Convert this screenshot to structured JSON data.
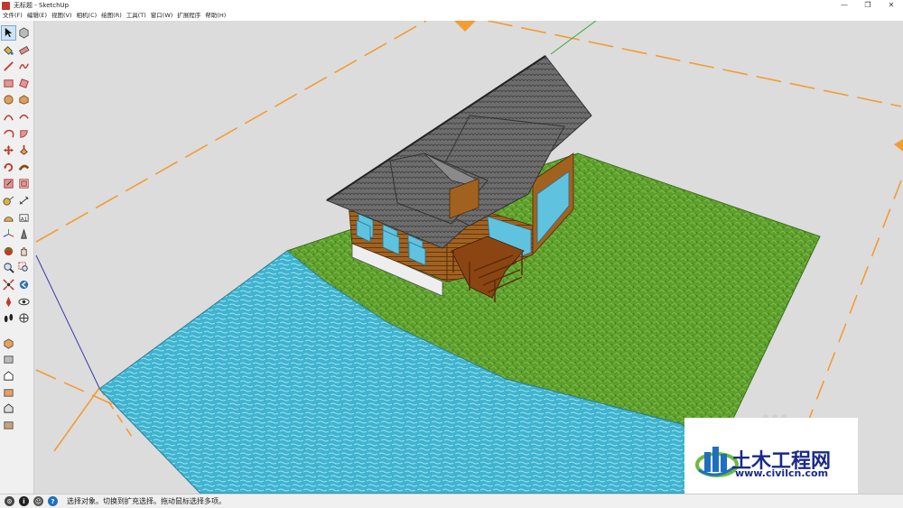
{
  "window": {
    "title": "无标题 - SketchUp",
    "controls": {
      "minimize": "—",
      "restore": "❐",
      "close": "✕"
    }
  },
  "menubar": {
    "items": [
      "文件(F)",
      "编辑(E)",
      "视图(V)",
      "相机(C)",
      "绘图(R)",
      "工具(T)",
      "窗口(W)",
      "扩展程序",
      "帮助(H)"
    ]
  },
  "toolbar": {
    "tools": [
      "select-icon",
      "component-icon",
      "paint-bucket-icon",
      "eraser-icon",
      "line-icon",
      "freehand-icon",
      "rectangle-icon",
      "rotated-rectangle-icon",
      "circle-icon",
      "polygon-icon",
      "arc-icon",
      "two-point-arc-icon",
      "three-point-arc-icon",
      "pie-icon",
      "move-icon",
      "push-pull-icon",
      "rotate-icon",
      "follow-me-icon",
      "scale-icon",
      "offset-icon",
      "tape-measure-icon",
      "dimension-icon",
      "protractor-icon",
      "text-icon",
      "axes-icon",
      "3d-text-icon",
      "orbit-icon",
      "pan-icon",
      "zoom-icon",
      "zoom-window-icon",
      "zoom-extents-icon",
      "previous-view-icon",
      "position-camera-icon",
      "look-around-icon",
      "walk-icon",
      "section-plane-icon",
      "iso-view-icon",
      "top-view-icon",
      "front-view-icon",
      "right-view-icon",
      "back-view-icon",
      "left-view-icon"
    ]
  },
  "watermark": {
    "title": "土木工程网",
    "url": "www.civilcn.com"
  },
  "statusbar": {
    "text": "选择对象。切换到扩充选择。拖动鼠标选择多项。"
  },
  "colors": {
    "grass": "#5e9e2e",
    "water": "#3fb3cf",
    "roof": "#6b6b6b",
    "wood": "#9a5a22",
    "glass": "#5fc3e0",
    "orange_axis": "#f39c34",
    "background": "#dcdcdc"
  }
}
